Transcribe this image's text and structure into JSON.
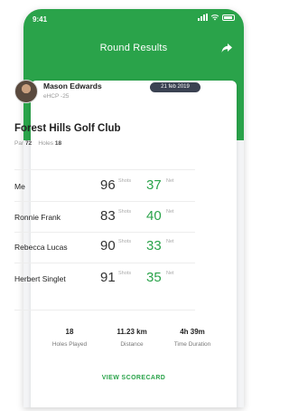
{
  "status_bar": {
    "time": "9:41"
  },
  "header": {
    "title": "Round Results"
  },
  "player": {
    "name": "Mason Edwards",
    "handicap": "eHCP -25",
    "date": "21 feb 2019"
  },
  "course": {
    "name": "Forest Hills Golf Club",
    "par_label": "Par",
    "par": "72",
    "holes_label": "Holes",
    "holes": "18"
  },
  "labels": {
    "shots": "Shots",
    "net": "Net"
  },
  "results": [
    {
      "name": "Me",
      "shots": "96",
      "net": "37"
    },
    {
      "name": "Ronnie Frank",
      "shots": "83",
      "net": "40"
    },
    {
      "name": "Rebecca Lucas",
      "shots": "90",
      "net": "33"
    },
    {
      "name": "Herbert Singlet",
      "shots": "91",
      "net": "35"
    }
  ],
  "stats": [
    {
      "value": "18",
      "label": "Holes Played"
    },
    {
      "value": "11.23 km",
      "label": "Distance"
    },
    {
      "value": "4h 39m",
      "label": "Time Duration"
    }
  ],
  "actions": {
    "view_scorecard": "VIEW SCORECARD"
  },
  "colors": {
    "brand_green": "#2aa34a",
    "badge_dark": "#3b4252"
  },
  "icons": [
    "signal-icon",
    "wifi-icon",
    "battery-icon",
    "share-icon"
  ]
}
